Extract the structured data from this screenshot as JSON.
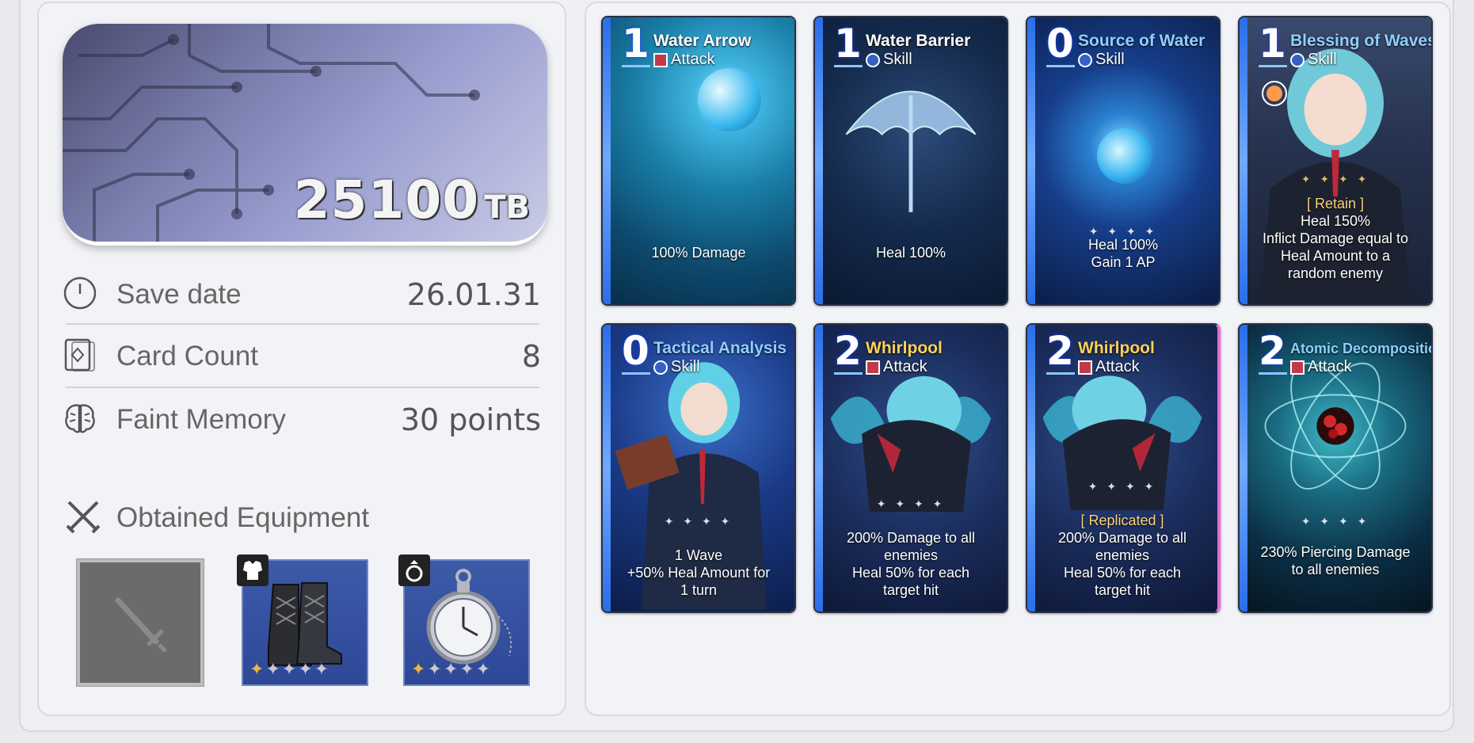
{
  "banner": {
    "amount": "25100",
    "unit": "TB"
  },
  "info": [
    {
      "label": "Save date",
      "value": "26.01.31",
      "icon": "clock-icon"
    },
    {
      "label": "Card Count",
      "value": "8",
      "icon": "cards-icon"
    },
    {
      "label": "Faint Memory",
      "value": "30 points",
      "icon": "brain-icon"
    }
  ],
  "equipment": {
    "title": "Obtained Equipment",
    "icon": "crossed-swords-icon",
    "slots": [
      {
        "state": "empty",
        "icon": "sword-icon"
      },
      {
        "state": "item",
        "badge": "armor-icon",
        "art": "boots",
        "stars": 1,
        "max_stars": 5
      },
      {
        "state": "item",
        "badge": "ring-icon",
        "art": "pocket-watch",
        "stars": 1,
        "max_stars": 5
      }
    ]
  },
  "cards": [
    {
      "cost": "1",
      "name": "Water Arrow",
      "type": "Attack",
      "desc_pre": "",
      "desc": [
        "100% Damage"
      ]
    },
    {
      "cost": "1",
      "name": "Water Barrier",
      "type": "Skill",
      "desc": [
        "Heal 100%"
      ]
    },
    {
      "cost": "0",
      "name": "Source of Water",
      "type": "Skill",
      "desc": [
        "Heal 100%",
        "Gain 1 AP"
      ]
    },
    {
      "cost": "1",
      "name": "Blessing of Waves",
      "type": "Skill",
      "tag": "[ Retain ]",
      "desc": [
        "Heal 150%",
        "Inflict Damage equal to",
        "Heal Amount to a",
        "random enemy"
      ]
    },
    {
      "cost": "0",
      "name": "Tactical Analysis",
      "type": "Skill",
      "desc": [
        "1 Wave",
        "+50% Heal Amount for",
        "1 turn"
      ]
    },
    {
      "cost": "2",
      "name": "Whirlpool",
      "type": "Attack",
      "desc": [
        "200% Damage to all",
        "enemies",
        "Heal 50% for each",
        "target hit"
      ]
    },
    {
      "cost": "2",
      "name": "Whirlpool",
      "type": "Attack",
      "tag": "[ Replicated ]",
      "desc": [
        "200% Damage to all",
        "enemies",
        "Heal 50% for each",
        "target hit"
      ]
    },
    {
      "cost": "2",
      "name": "Atomic Decomposition",
      "type": "Attack",
      "desc": [
        "230% Piercing Damage",
        "to all enemies"
      ]
    }
  ]
}
